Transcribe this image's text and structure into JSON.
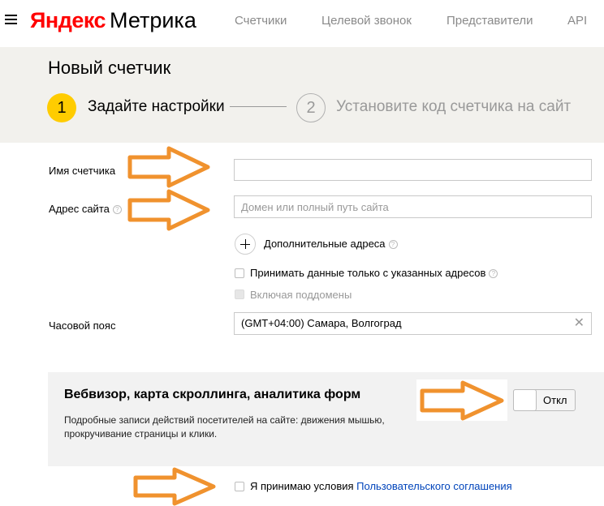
{
  "header": {
    "logo_yandex": "Яндекс",
    "logo_metrika": "Метрика",
    "nav": [
      "Счетчики",
      "Целевой звонок",
      "Представители",
      "API"
    ]
  },
  "title": "Новый счетчик",
  "steps": [
    {
      "number": "1",
      "label": "Задайте настройки"
    },
    {
      "number": "2",
      "label": "Установите код счетчика на сайт"
    }
  ],
  "form": {
    "name_label": "Имя счетчика",
    "name_value": "",
    "address_label": "Адрес сайта",
    "address_placeholder": "Домен или полный путь сайта",
    "help_glyph": "?",
    "add_addresses": "Дополнительные адреса",
    "only_specified": "Принимать данные только с указанных адресов",
    "include_subdomains": "Включая поддомены",
    "timezone_label": "Часовой пояс",
    "timezone_value": "(GMT+04:00) Самара, Волгоград",
    "clear_glyph": "✕"
  },
  "webvisor": {
    "title": "Вебвизор, карта скроллинга, аналитика форм",
    "description": "Подробные записи действий посетителей на сайте: движения мышью, прокручивание страницы и клики.",
    "toggle_label": "Откл"
  },
  "agreement": {
    "text": "Я принимаю условия",
    "link": "Пользовательского соглашения"
  },
  "colors": {
    "accent_yellow": "#ffcc00",
    "logo_red": "#ff0000",
    "link_blue": "#0044bb",
    "band_bg": "#f2f1ed",
    "annotation_arrow": "#f0922e"
  },
  "icons": {
    "menu": "hamburger-icon",
    "help": "question-circle-icon",
    "add": "plus-icon",
    "clear": "close-icon",
    "annotation": "arrow-right-icon"
  }
}
